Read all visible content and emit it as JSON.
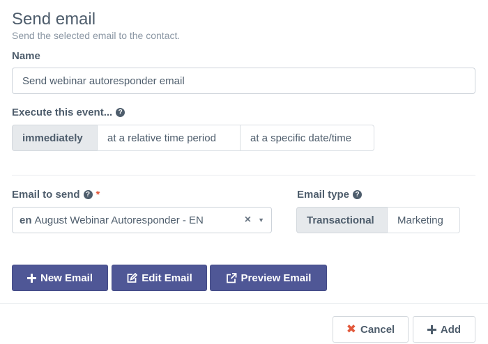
{
  "header": {
    "title": "Send email",
    "subtitle": "Send the selected email to the contact."
  },
  "name_field": {
    "label": "Name",
    "value": "Send webinar autoresponder email"
  },
  "execute": {
    "label": "Execute this event...",
    "options": [
      "immediately",
      "at a relative time period",
      "at a specific date/time"
    ],
    "selected": "immediately"
  },
  "email_to_send": {
    "label": "Email to send",
    "required_mark": "*",
    "lang": "en",
    "value": "August Webinar Autoresponder - EN"
  },
  "email_type": {
    "label": "Email type",
    "options": [
      "Transactional",
      "Marketing"
    ],
    "selected": "Transactional"
  },
  "actions": {
    "new_email": "New Email",
    "edit_email": "Edit Email",
    "preview_email": "Preview Email"
  },
  "footer": {
    "cancel": "Cancel",
    "add": "Add"
  },
  "colors": {
    "primary": "#4f5796",
    "danger": "#e2593c",
    "text": "#4e5d6c"
  }
}
